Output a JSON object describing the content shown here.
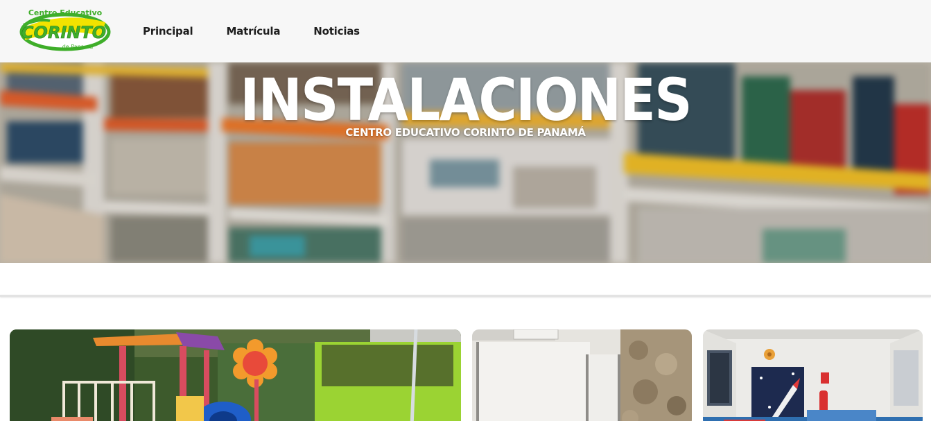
{
  "header": {
    "logo": {
      "top_text": "Centro Educativo",
      "main_text": "CORINTO",
      "bottom_text": "de Panamá"
    },
    "nav": [
      {
        "label": "Principal"
      },
      {
        "label": "Matrícula"
      },
      {
        "label": "Noticias"
      }
    ]
  },
  "hero": {
    "title": "INSTALACIONES",
    "subtitle": "CENTRO EDUCATIVO CORINTO DE PANAMÁ"
  },
  "gallery": [
    {
      "image": "playground-photo"
    },
    {
      "image": "classroom-photo"
    },
    {
      "image": "hallway-photo"
    }
  ],
  "colors": {
    "header_bg": "#f7f7f7",
    "logo_green": "#3fae2a",
    "logo_yellow": "#f2e300",
    "nav_text": "#1e1e1e",
    "hero_text": "#ffffff"
  }
}
